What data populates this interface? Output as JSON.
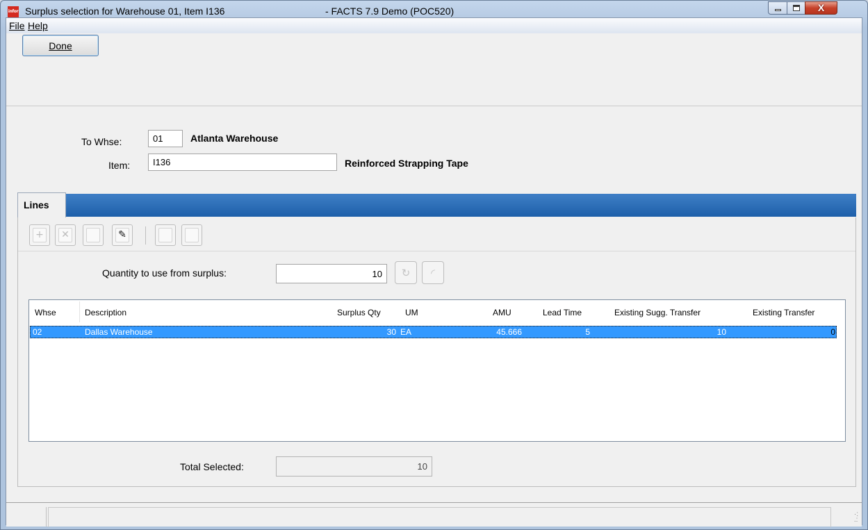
{
  "window": {
    "title": "Surplus selection for Warehouse 01, Item I136",
    "app_title": "- FACTS 7.9 Demo (POC520)",
    "logo_text": "infor",
    "close_glyph": "X"
  },
  "menu": {
    "file": "File",
    "help": "Help"
  },
  "toolbar": {
    "done_label": "Done"
  },
  "header": {
    "to_whse_label": "To Whse:",
    "to_whse_value": "01",
    "to_whse_name": "Atlanta Warehouse",
    "item_label": "Item:",
    "item_value": "I136",
    "item_description": "Reinforced Strapping Tape"
  },
  "tabs": [
    {
      "label": "Lines",
      "active": true
    }
  ],
  "lines_toolbar": {
    "buttons": [
      {
        "icon": "add-icon",
        "glyph": "+",
        "enabled": false
      },
      {
        "icon": "delete-icon",
        "glyph": "✕",
        "enabled": false
      },
      {
        "icon": "blank-icon",
        "glyph": "",
        "enabled": false
      },
      {
        "icon": "edit-icon",
        "glyph": "✎",
        "enabled": true
      },
      {
        "icon": "blank-icon",
        "glyph": "",
        "enabled": false
      },
      {
        "icon": "blank-icon",
        "glyph": "",
        "enabled": false
      }
    ]
  },
  "quantity": {
    "label": "Quantity to use from surplus:",
    "value": "10"
  },
  "grid": {
    "columns": [
      "Whse",
      "Description",
      "Surplus Qty",
      "UM",
      "AMU",
      "Lead Time",
      "Existing Sugg. Transfer",
      "Existing Transfer"
    ],
    "rows": [
      {
        "whse": "02",
        "description": "Dallas Warehouse",
        "surplus_qty": "30",
        "um": "EA",
        "amu": "45.666",
        "lead_time": "5",
        "existing_sugg_transfer": "10",
        "existing_transfer": "0",
        "selected": true
      }
    ]
  },
  "total": {
    "label": "Total Selected:",
    "value": "10"
  },
  "colors": {
    "tab_bar": "#1d5fa9",
    "selection": "#3399ff",
    "close_button": "#c6422a"
  }
}
